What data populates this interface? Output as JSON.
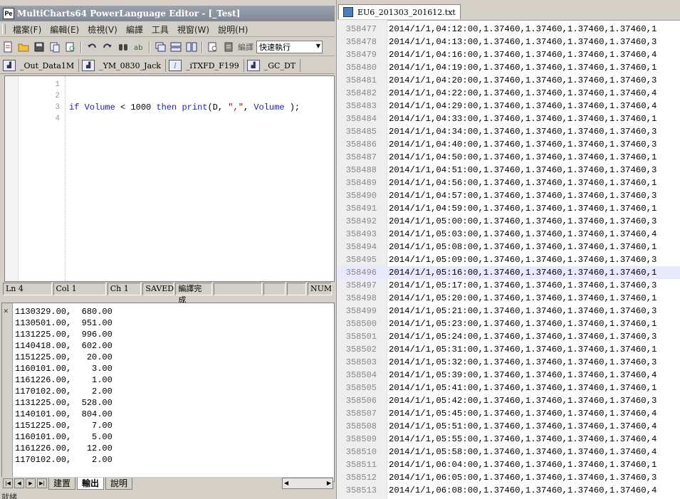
{
  "top_strip_text": "",
  "title": "MultiCharts64 PowerLanguage Editor - [_Test]",
  "menu": [
    "檔案(F)",
    "編輯(E)",
    "檢視(V)",
    "編譯",
    "工具",
    "視窗(W)",
    "說明(H)"
  ],
  "toolbar": {
    "compile_label": "編譯",
    "speed_value": "快速執行"
  },
  "doc_tabs": [
    "_Out_Data1M",
    "_YM_0830_Jack",
    "_iTXFD_F199",
    "_GC_DT"
  ],
  "editor": {
    "line_numbers": [
      "1",
      "2",
      "3",
      "4"
    ],
    "code": {
      "kw_if": "if",
      "var_volume": "Volume",
      "op_lt": "<",
      "num_1000": "1000",
      "kw_then": "then",
      "fn_print": "print",
      "args_open": "(D,",
      "str_comma": "\",\"",
      "comma": ",",
      "var_volume2": "Volume",
      "close": ");"
    }
  },
  "status_bar": {
    "line": "Ln 4",
    "col": "Col 1",
    "ch": "Ch 1",
    "saved": "SAVED",
    "compile_status": "編譯完成",
    "num": "NUM"
  },
  "output_lines": [
    "1130329.00,  680.00",
    "1130501.00,  951.00",
    "1131225.00,  996.00",
    "1140418.00,  602.00",
    "1151225.00,   20.00",
    "1160101.00,    3.00",
    "1161226.00,    1.00",
    "1170102.00,    2.00",
    "1131225.00,  528.00",
    "1140101.00,  804.00",
    "1151225.00,    7.00",
    "1160101.00,    5.00",
    "1161226.00,   12.00",
    "1170102.00,    2.00"
  ],
  "bottom_tabs": [
    "建置",
    "輸出",
    "說明"
  ],
  "bottom_left_text": "就緒",
  "right_file_tab": "EU6_201303_201612.txt",
  "file_lines": [
    {
      "n": "358477",
      "t": "2014/1/1,04:12:00,1.37460,1.37460,1.37460,1.37460,1"
    },
    {
      "n": "358478",
      "t": "2014/1/1,04:13:00,1.37460,1.37460,1.37460,1.37460,3"
    },
    {
      "n": "358479",
      "t": "2014/1/1,04:16:00,1.37460,1.37460,1.37460,1.37460,4"
    },
    {
      "n": "358480",
      "t": "2014/1/1,04:19:00,1.37460,1.37460,1.37460,1.37460,1"
    },
    {
      "n": "358481",
      "t": "2014/1/1,04:20:00,1.37460,1.37460,1.37460,1.37460,3"
    },
    {
      "n": "358482",
      "t": "2014/1/1,04:22:00,1.37460,1.37460,1.37460,1.37460,4"
    },
    {
      "n": "358483",
      "t": "2014/1/1,04:29:00,1.37460,1.37460,1.37460,1.37460,4"
    },
    {
      "n": "358484",
      "t": "2014/1/1,04:33:00,1.37460,1.37460,1.37460,1.37460,1"
    },
    {
      "n": "358485",
      "t": "2014/1/1,04:34:00,1.37460,1.37460,1.37460,1.37460,3"
    },
    {
      "n": "358486",
      "t": "2014/1/1,04:40:00,1.37460,1.37460,1.37460,1.37460,3"
    },
    {
      "n": "358487",
      "t": "2014/1/1,04:50:00,1.37460,1.37460,1.37460,1.37460,1"
    },
    {
      "n": "358488",
      "t": "2014/1/1,04:51:00,1.37460,1.37460,1.37460,1.37460,3"
    },
    {
      "n": "358489",
      "t": "2014/1/1,04:56:00,1.37460,1.37460,1.37460,1.37460,1"
    },
    {
      "n": "358490",
      "t": "2014/1/1,04:57:00,1.37460,1.37460,1.37460,1.37460,3"
    },
    {
      "n": "358491",
      "t": "2014/1/1,04:59:00,1.37460,1.37460,1.37460,1.37460,1"
    },
    {
      "n": "358492",
      "t": "2014/1/1,05:00:00,1.37460,1.37460,1.37460,1.37460,3"
    },
    {
      "n": "358493",
      "t": "2014/1/1,05:03:00,1.37460,1.37460,1.37460,1.37460,4"
    },
    {
      "n": "358494",
      "t": "2014/1/1,05:08:00,1.37460,1.37460,1.37460,1.37460,1"
    },
    {
      "n": "358495",
      "t": "2014/1/1,05:09:00,1.37460,1.37460,1.37460,1.37460,3"
    },
    {
      "n": "358496",
      "t": "2014/1/1,05:16:00,1.37460,1.37460,1.37460,1.37460,1"
    },
    {
      "n": "358497",
      "t": "2014/1/1,05:17:00,1.37460,1.37460,1.37460,1.37460,3"
    },
    {
      "n": "358498",
      "t": "2014/1/1,05:20:00,1.37460,1.37460,1.37460,1.37460,1"
    },
    {
      "n": "358499",
      "t": "2014/1/1,05:21:00,1.37460,1.37460,1.37460,1.37460,3"
    },
    {
      "n": "358500",
      "t": "2014/1/1,05:23:00,1.37460,1.37460,1.37460,1.37460,1"
    },
    {
      "n": "358501",
      "t": "2014/1/1,05:24:00,1.37460,1.37460,1.37460,1.37460,3"
    },
    {
      "n": "358502",
      "t": "2014/1/1,05:31:00,1.37460,1.37460,1.37460,1.37460,1"
    },
    {
      "n": "358503",
      "t": "2014/1/1,05:32:00,1.37460,1.37460,1.37460,1.37460,3"
    },
    {
      "n": "358504",
      "t": "2014/1/1,05:39:00,1.37460,1.37460,1.37460,1.37460,4"
    },
    {
      "n": "358505",
      "t": "2014/1/1,05:41:00,1.37460,1.37460,1.37460,1.37460,1"
    },
    {
      "n": "358506",
      "t": "2014/1/1,05:42:00,1.37460,1.37460,1.37460,1.37460,3"
    },
    {
      "n": "358507",
      "t": "2014/1/1,05:45:00,1.37460,1.37460,1.37460,1.37460,4"
    },
    {
      "n": "358508",
      "t": "2014/1/1,05:51:00,1.37460,1.37460,1.37460,1.37460,4"
    },
    {
      "n": "358509",
      "t": "2014/1/1,05:55:00,1.37460,1.37460,1.37460,1.37460,4"
    },
    {
      "n": "358510",
      "t": "2014/1/1,05:58:00,1.37460,1.37460,1.37460,1.37460,4"
    },
    {
      "n": "358511",
      "t": "2014/1/1,06:04:00,1.37460,1.37460,1.37460,1.37460,1"
    },
    {
      "n": "358512",
      "t": "2014/1/1,06:05:00,1.37460,1.37460,1.37460,1.37460,3"
    },
    {
      "n": "358513",
      "t": "2014/1/1,06:08:00,1.37460,1.37460,1.37460,1.37460,4"
    }
  ],
  "highlighted_line": "358496",
  "colors": {
    "keyword": "#1a1acc",
    "string": "#cc0000",
    "highlight": "#e8e8ff"
  }
}
